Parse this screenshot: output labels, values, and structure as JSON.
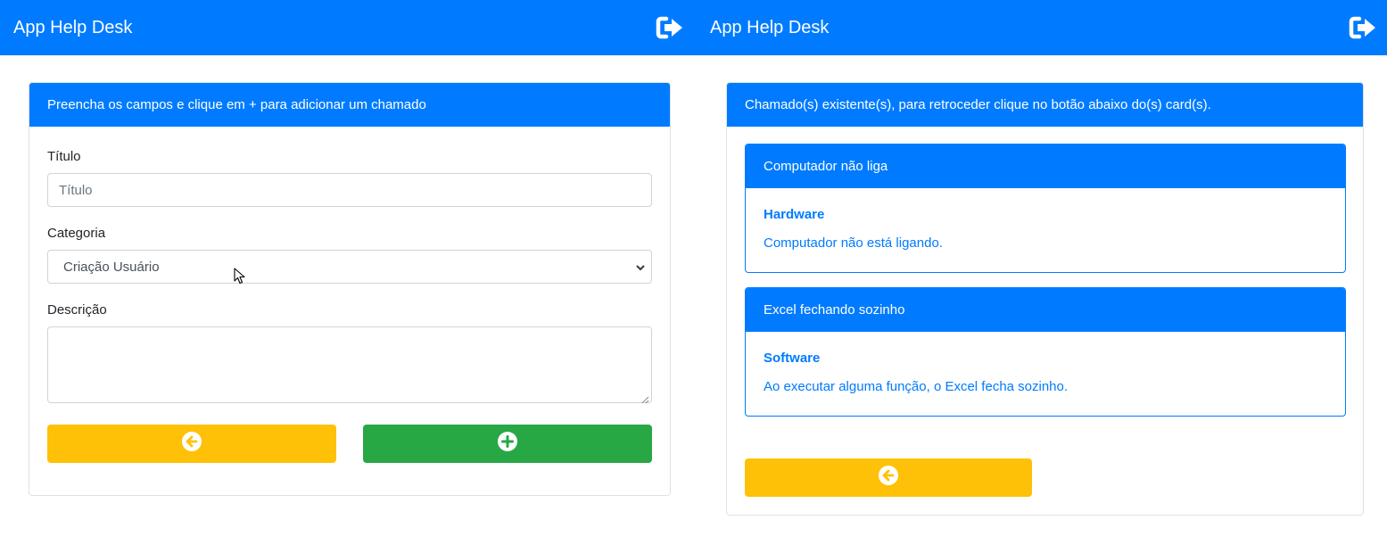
{
  "app": {
    "brand": "App Help Desk",
    "primary_color": "#007bff",
    "logout_icon": "sign-out-icon"
  },
  "form": {
    "header": "Preencha os campos e clique em + para adicionar um chamado",
    "title_label": "Título",
    "title_placeholder": "Título",
    "title_value": "",
    "category_label": "Categoria",
    "category_selected": "Criação Usuário",
    "description_label": "Descrição",
    "description_value": "",
    "back_button_icon": "arrow-circle-left-icon",
    "add_button_icon": "plus-circle-icon",
    "back_button_color": "#ffc107",
    "add_button_color": "#28a745"
  },
  "tickets": {
    "header": "Chamado(s) existente(s), para retroceder clique no botão abaixo do(s) card(s).",
    "items": [
      {
        "title": "Computador não liga",
        "category": "Hardware",
        "description": "Computador não está ligando."
      },
      {
        "title": "Excel fechando sozinho",
        "category": "Software",
        "description": "Ao executar alguma função, o Excel fecha sozinho."
      }
    ],
    "back_button_icon": "arrow-circle-left-icon"
  }
}
